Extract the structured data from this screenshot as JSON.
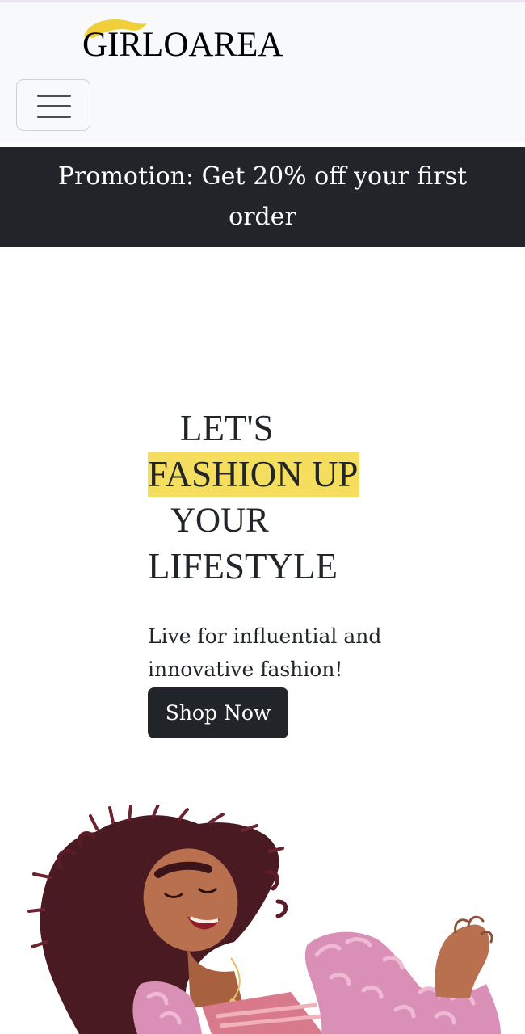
{
  "brand": {
    "name": "GIRLOAREA",
    "accent_color": "#f0cf3a"
  },
  "navbar": {
    "toggler_icon": "hamburger-menu-icon"
  },
  "promo": {
    "text": "Promotion: Get 20% off your first order"
  },
  "hero": {
    "headline_line1": "LET'S",
    "headline_line2": "FASHION UP",
    "headline_line3": "YOUR",
    "headline_line4": "LIFESTYLE",
    "highlight_color": "#f5dd5d",
    "subtitle": "Live for influential and innovative fashion!",
    "cta_label": "Shop Now"
  },
  "colors": {
    "dark": "#212529",
    "navbar_bg": "#f8f9fa"
  }
}
